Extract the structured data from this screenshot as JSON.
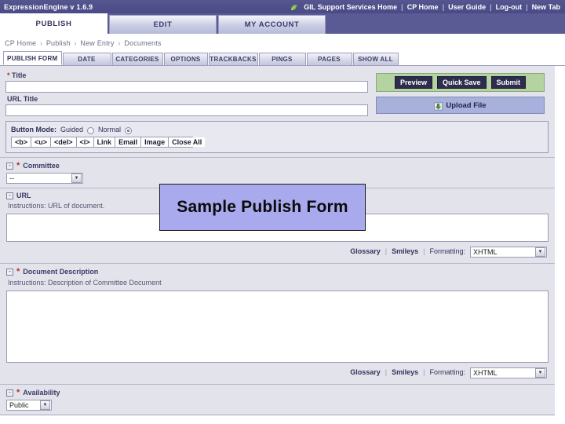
{
  "header": {
    "brand": "ExpressionEngine  v 1.6.9",
    "leaf_icon": "leaf-icon",
    "links": [
      {
        "label": "GIL Support Services Home"
      },
      {
        "label": "CP Home"
      },
      {
        "label": "User Guide"
      },
      {
        "label": "Log-out"
      },
      {
        "label": "New Tab"
      }
    ],
    "separator": "|"
  },
  "main_tabs": [
    {
      "label": "PUBLISH",
      "active": true
    },
    {
      "label": "EDIT",
      "active": false
    },
    {
      "label": "MY ACCOUNT",
      "active": false
    }
  ],
  "breadcrumb": {
    "items": [
      "CP Home",
      "Publish",
      "New Entry",
      "Documents"
    ],
    "arrow": "›"
  },
  "sub_tabs": [
    {
      "label": "PUBLISH FORM",
      "active": true
    },
    {
      "label": "DATE",
      "active": false
    },
    {
      "label": "CATEGORIES",
      "active": false
    },
    {
      "label": "OPTIONS",
      "active": false
    },
    {
      "label": "TRACKBACKS",
      "active": false
    },
    {
      "label": "PINGS",
      "active": false
    },
    {
      "label": "PAGES",
      "active": false
    },
    {
      "label": "SHOW ALL",
      "active": false
    }
  ],
  "form": {
    "title_label": "Title",
    "title_required": "*",
    "title_value": "",
    "url_title_label": "URL Title",
    "url_title_value": ""
  },
  "actions": {
    "preview_label": "Preview",
    "quick_save_label": "Quick Save",
    "submit_label": "Submit",
    "upload_label": "Upload File",
    "upload_icon": "upload-icon",
    "panel_color": "#b4d3a0",
    "upload_panel_color": "#a8b0dc"
  },
  "button_mode": {
    "label": "Button Mode:",
    "guided_label": "Guided",
    "normal_label": "Normal",
    "selected": "Normal",
    "tags": [
      "<b>",
      "<u>",
      "<del>",
      "<i>",
      "Link",
      "Email",
      "Image",
      "Close All"
    ]
  },
  "sections": {
    "committee": {
      "toggle": "-",
      "required": "*",
      "title": "Committee",
      "select_value": "--"
    },
    "url": {
      "toggle": "-",
      "required": "",
      "title": "URL",
      "instructions": "Instructions: URL of document.",
      "value": ""
    },
    "document_description": {
      "toggle": "-",
      "required": "*",
      "title": "Document Description",
      "instructions": "Instructions: Description of Committee Document",
      "value": ""
    },
    "availability": {
      "toggle": "-",
      "required": "*",
      "title": "Availability",
      "select_value": "Public"
    }
  },
  "tools": {
    "glossary_label": "Glossary",
    "smileys_label": "Smileys",
    "formatting_label": "Formatting:",
    "formatting_value": "XHTML",
    "separator": "|"
  },
  "callout": {
    "text": "Sample Publish Form",
    "bg_color": "#a9a9ee"
  }
}
